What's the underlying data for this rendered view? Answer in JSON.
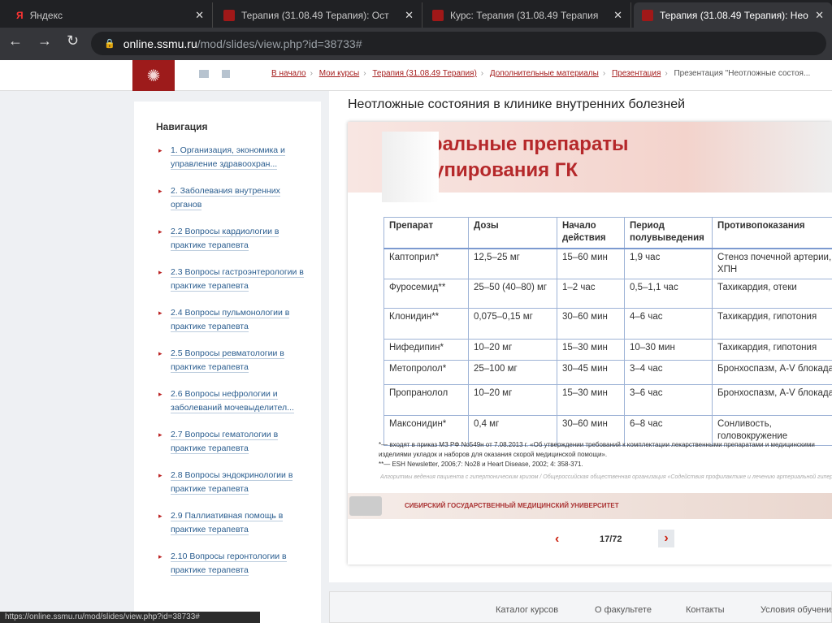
{
  "browser": {
    "tabs": [
      {
        "label": "Яндекс"
      },
      {
        "label": "Терапия (31.08.49 Терапия): Ост"
      },
      {
        "label": "Курс: Терапия (31.08.49 Терапия"
      },
      {
        "label": "Терапия (31.08.49 Терапия): Нео"
      }
    ],
    "url_domain": "online.ssmu.ru",
    "url_path": "/mod/slides/view.php?id=38733#",
    "status_url": "https://online.ssmu.ru/mod/slides/view.php?id=38733#"
  },
  "breadcrumb": [
    "В начало",
    "Мои курсы",
    "Терапия (31.08.49 Терапия)",
    "Дополнительные материалы",
    "Презентация"
  ],
  "breadcrumb_current": "Презентация \"Неотложные состоя...",
  "nav": {
    "title": "Навигация",
    "items": [
      "1. Организация, экономика и управление здравоохран...",
      "2. Заболевания внутренних органов",
      "2.2 Вопросы кардиологии в практике терапевта",
      "2.3 Вопросы гастроэнтерологии в практике терапевта",
      "2.4 Вопросы пульмонологии в практике терапевта",
      "2.5 Вопросы ревматологии в практике терапевта",
      "2.6 Вопросы нефрологии и заболеваний мочевыделител...",
      "2.7 Вопросы гематологии в практике терапевта",
      "2.8 Вопросы эндокринологии в практике терапевта",
      "2.9 Паллиативная помощь в практике терапевта",
      "2.10 Вопросы геронтологии в практике терапевта"
    ]
  },
  "page_title": "Неотложные состояния в клинике внутренних болезней",
  "slide": {
    "title_line1": "Пероральные препараты",
    "title_line2": "для купирования ГК",
    "headers": [
      "Препарат",
      "Дозы",
      "Начало действия",
      "Период полувыведения",
      "Противопоказания"
    ],
    "rows": [
      [
        "Каптоприл*",
        "12,5–25 мг",
        "15–60 мин",
        "1,9 час",
        "Стеноз почечной артерии, ХПН"
      ],
      [
        "Фуросемид**",
        "25–50 (40–80) мг",
        "1–2 час",
        "0,5–1,1 час",
        "Тахикардия, отеки"
      ],
      [
        "Клонидин**",
        "0,075–0,15 мг",
        "30–60 мин",
        "4–6 час",
        "Тахикардия, гипотония"
      ],
      [
        "Нифедипин*",
        "10–20 мг",
        "15–30 мин",
        "10–30 мин",
        "Тахикардия, гипотония"
      ],
      [
        "Метопролол*",
        "25–100 мг",
        "30–45 мин",
        "3–4 час",
        "Бронхоспазм, A-V блокада"
      ],
      [
        "Пропранолол",
        "10–20 мг",
        "15–30 мин",
        "3–6 час",
        "Бронхоспазм, A-V блокада"
      ],
      [
        "Максонидин*",
        "0,4 мг",
        "30–60 мин",
        "6–8 час",
        "Сонливость, головокружение"
      ]
    ],
    "note1": "*— входят в приказ МЗ РФ No549н от 7.08.2013 г. «Об утверждении требований к комплектации лекарственными препаратами и медицинскими изделиями укладок и наборов для оказания скорой медицинской помощи».",
    "note2": "**— ESH Newsletter, 2006;7: No28 и Heart Disease, 2002; 4: 358-371.",
    "source": "Алгоритмы ведения пациента с гипертоническим кризом / Общероссийская общественная организация «Содействия профилактике и лечению артериальной гипертензии «Антигипертензивная Лига» — СПб",
    "university": "СИБИРСКИЙ ГОСУДАРСТВЕННЫЙ МЕДИЦИНСКИЙ УНИВЕРСИТЕТ"
  },
  "pager": {
    "current": "17/72",
    "prev": "‹",
    "next": "›"
  },
  "footer": [
    "Каталог курсов",
    "О факультете",
    "Контакты",
    "Условия обучения"
  ]
}
